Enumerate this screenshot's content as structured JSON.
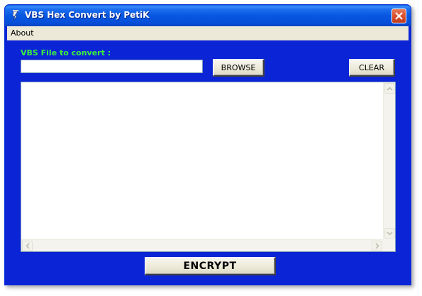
{
  "window": {
    "title": "VBS Hex Convert by PetiK"
  },
  "menu": {
    "items": [
      "About"
    ]
  },
  "form": {
    "file_label": "VBS File to convert :",
    "file_value": "",
    "browse_label": "BROWSE",
    "clear_label": "CLEAR",
    "output_text": "",
    "encrypt_label": "ENCRYPT"
  },
  "icons": {
    "title": "script-icon",
    "close": "close-icon",
    "scroll_up": "arrow-up-icon",
    "scroll_down": "arrow-down-icon",
    "scroll_left": "arrow-left-icon",
    "scroll_right": "arrow-right-icon"
  },
  "colors": {
    "client_background": "#0a24d6",
    "label_green": "#3cf03c",
    "titlebar_blue": "#0857e0",
    "close_red": "#d8502e"
  }
}
